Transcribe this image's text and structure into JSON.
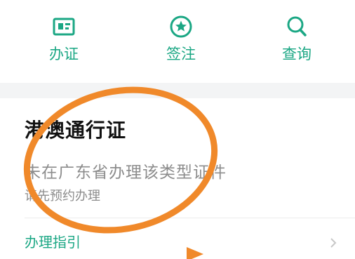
{
  "nav": {
    "items": [
      {
        "label": "办证",
        "icon": "id-card-icon"
      },
      {
        "label": "签注",
        "icon": "star-badge-icon"
      },
      {
        "label": "查询",
        "icon": "search-icon"
      }
    ]
  },
  "card": {
    "title": "港澳通行证",
    "description": "未在广东省办理该类型证件",
    "hint": "请先预约办理",
    "guide_label": "办理指引"
  },
  "colors": {
    "accent": "#1ba784",
    "annotation": "#f0892a",
    "muted_text": "#8c8c8c",
    "band": "#f3f4f5"
  }
}
